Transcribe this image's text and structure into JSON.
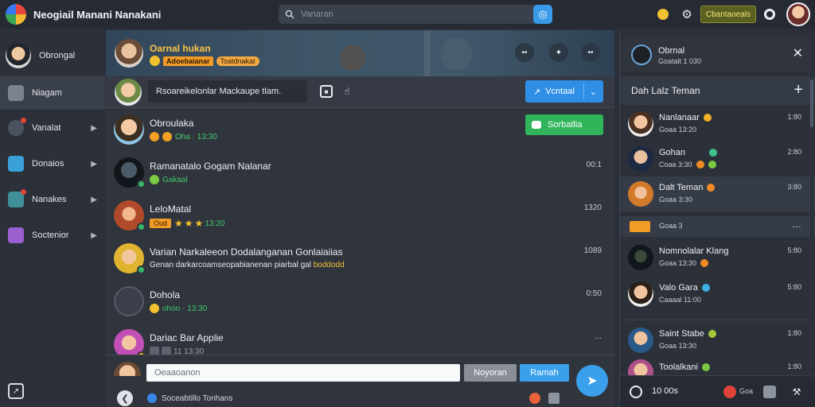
{
  "app": {
    "title": "Neogiail Manani Nanakani"
  },
  "search": {
    "placeholder": "Vanaran"
  },
  "topbar": {
    "action_label": "Cbantaoeals"
  },
  "nav": {
    "profile": "Obrongal",
    "items": [
      {
        "label": "Niagam"
      },
      {
        "label": "Vanalat"
      },
      {
        "label": "Donaios"
      },
      {
        "label": "Nanakes"
      },
      {
        "label": "Soctenior"
      }
    ]
  },
  "chat": {
    "name": "Oarnal hukan",
    "badge1": "Adoebaianar",
    "badge2": "Toatdnakat",
    "compose": "Rsoareikelonlar Mackaupe tlam.",
    "action": "Vcntaal",
    "green_action": "Sorbatlia",
    "rows": [
      {
        "name": "Obroulaka",
        "sub": "Oha  · 13:30",
        "time": ""
      },
      {
        "name": "Ramanatalo Gogam Nalanar",
        "sub": "Gakaal",
        "time": "00:1"
      },
      {
        "name": "LeloMatal",
        "sub": "13:20",
        "tag": "Oud",
        "time": "1320"
      },
      {
        "name": "Varian Narkaleeon Dodalanganan Gonlaiaiias",
        "sub": "Genan darkarcoamseopabianenan piarbal gal",
        "sub_hl": "boddodd",
        "time": "1089"
      },
      {
        "name": "Dohola",
        "sub": "ohoo · 13:30",
        "time": "0:50"
      },
      {
        "name": "Dariac Bar Applie",
        "sub": "11 13:30",
        "time": "..."
      }
    ]
  },
  "footer": {
    "placeholder": "Oeaaoanon",
    "btn_secondary": "Noyoran",
    "btn_primary": "Ramah",
    "info": "Soceabtillo Tonhans"
  },
  "panel": {
    "title": "Obrnal",
    "subtitle": "Goatalt 1 030",
    "section": "Dah Lalz Teman",
    "friends": [
      {
        "name": "Nanlanaar",
        "sub": "Goaa 13:20",
        "time": "1:80"
      },
      {
        "name": "Gohan",
        "sub": "Coaa 3:30",
        "time": "2:80"
      },
      {
        "name": "Dalt Teman",
        "sub": "Goaa 3:30",
        "time": "3:80"
      },
      {
        "name": "Nomnolalar Klang",
        "sub": "Goaa 13:30",
        "time": "5:80"
      },
      {
        "name": "Valo Gara",
        "sub": "Caaaal 11:00",
        "time": "5:80"
      },
      {
        "name": "Saint Stabe",
        "sub": "Goaa 13:30",
        "time": "1:80"
      },
      {
        "name": "Toolalkani",
        "sub": "",
        "time": "1:80"
      }
    ],
    "extra": "Goaa 3",
    "footer_count": "10 00s",
    "footer_sub": "Goa"
  }
}
